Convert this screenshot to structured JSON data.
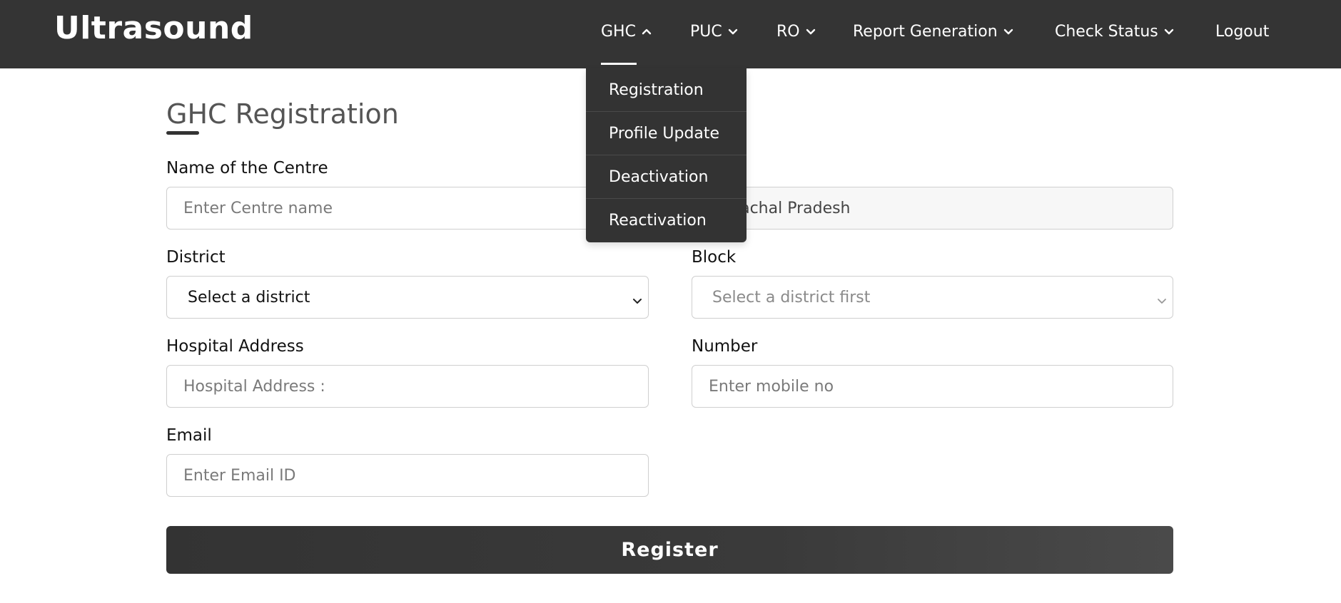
{
  "navbar": {
    "brand": "Ultrasound",
    "items": [
      {
        "label": "GHC",
        "expanded": true
      },
      {
        "label": "PUC"
      },
      {
        "label": "RO"
      },
      {
        "label": "Report Generation"
      },
      {
        "label": "Check Status"
      },
      {
        "label": "Logout"
      }
    ]
  },
  "dropdown": {
    "items": [
      "Registration",
      "Profile Update",
      "Deactivation",
      "Reactivation"
    ]
  },
  "form": {
    "title": "GHC Registration",
    "centre_name": {
      "label": "Name of the Centre",
      "placeholder": "Enter Centre name"
    },
    "state": {
      "value": "Himachal Pradesh"
    },
    "district": {
      "label": "District",
      "selected": "Select a district"
    },
    "block": {
      "label": "Block",
      "selected": "Select a district first"
    },
    "address": {
      "label": "Hospital Address",
      "placeholder": "Hospital Address :"
    },
    "number": {
      "label": "Number",
      "placeholder": "Enter mobile no"
    },
    "email": {
      "label": "Email",
      "placeholder": "Enter Email ID"
    },
    "submit_label": "Register"
  },
  "icons": {
    "chevron": "chevron-down-icon",
    "chevron_up": "chevron-up-icon"
  },
  "colors": {
    "navbar_bg": "#343434",
    "button_bg": "#333333"
  }
}
